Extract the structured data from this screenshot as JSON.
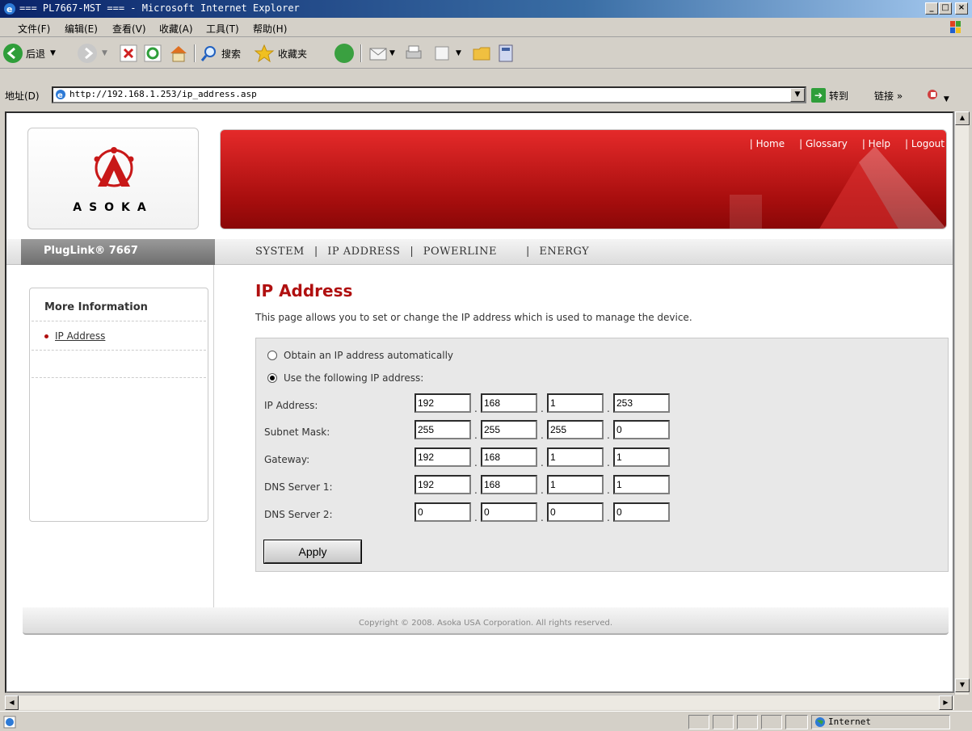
{
  "window": {
    "title": "=== PL7667-MST === - Microsoft Internet Explorer"
  },
  "menu": [
    "文件(F)",
    "编辑(E)",
    "查看(V)",
    "收藏(A)",
    "工具(T)",
    "帮助(H)"
  ],
  "toolbar": {
    "back": "后退",
    "search": "搜索",
    "favorites": "收藏夹"
  },
  "address": {
    "label": "地址(D)",
    "url": "http://192.168.1.253/ip_address.asp",
    "go": "转到",
    "links": "链接 »"
  },
  "status": {
    "zone": "Internet"
  },
  "site": {
    "brand": "ASOKA",
    "header_links": [
      "| Home",
      "| Glossary",
      "| Help",
      "| Logout"
    ],
    "product": "PlugLink® 7667",
    "nav": [
      "SYSTEM",
      "IP ADDRESS",
      "POWERLINE",
      "ENERGY"
    ],
    "sidebar": {
      "title": "More Information",
      "items": [
        "IP Address"
      ]
    },
    "page_title": "IP Address",
    "description": "This page allows you to set or change the IP address which is used to manage the device.",
    "radio_auto": "Obtain an IP address automatically",
    "radio_manual": "Use the following IP address:",
    "selected_mode": "manual",
    "fields": [
      {
        "label": "IP Address:",
        "octets": [
          "192",
          "168",
          "1",
          "253"
        ]
      },
      {
        "label": "Subnet Mask:",
        "octets": [
          "255",
          "255",
          "255",
          "0"
        ]
      },
      {
        "label": "Gateway:",
        "octets": [
          "192",
          "168",
          "1",
          "1"
        ]
      },
      {
        "label": "DNS Server 1:",
        "octets": [
          "192",
          "168",
          "1",
          "1"
        ]
      },
      {
        "label": "DNS Server 2:",
        "octets": [
          "0",
          "0",
          "0",
          "0"
        ]
      }
    ],
    "apply": "Apply",
    "copyright": "Copyright © 2008. Asoka USA Corporation. All rights reserved."
  },
  "colors": {
    "accent": "#b01010",
    "banner": "#c41414",
    "titlebar": "#0a246a"
  }
}
